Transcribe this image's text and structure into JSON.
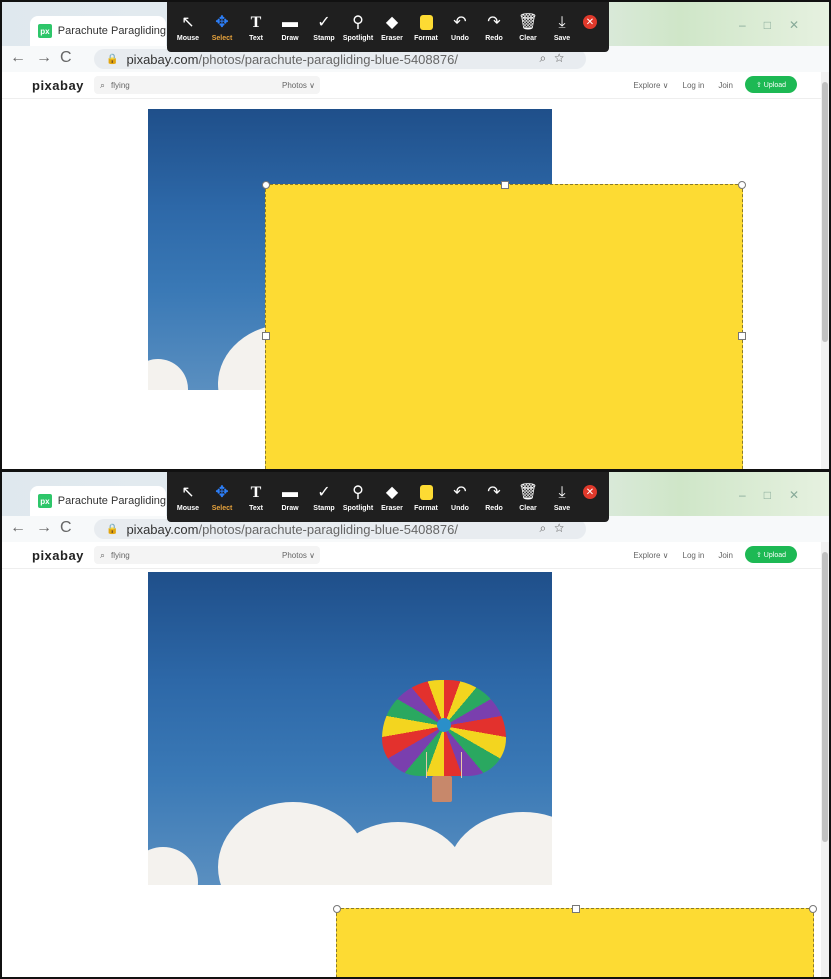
{
  "browser": {
    "tab_title": "Parachute Paragliding Blue - Free",
    "favicon_text": "px",
    "url_domain": "pixabay.com",
    "url_path": "/photos/parachute-paragliding-blue-5408876/",
    "back_icon": "arrow-left",
    "forward_icon": "arrow-right",
    "reload_icon": "reload"
  },
  "zoom_toolbar": {
    "tools": [
      {
        "label": "Mouse",
        "icon": "cursor-icon",
        "glyph": "↖"
      },
      {
        "label": "Select",
        "icon": "move-icon",
        "glyph": "✥"
      },
      {
        "label": "Text",
        "icon": "text-icon",
        "glyph": "T"
      },
      {
        "label": "Draw",
        "icon": "rectangle-icon",
        "glyph": "▬"
      },
      {
        "label": "Stamp",
        "icon": "checkmark-icon",
        "glyph": "✓"
      },
      {
        "label": "Spotlight",
        "icon": "spotlight-icon",
        "glyph": "⚲"
      },
      {
        "label": "Eraser",
        "icon": "eraser-icon",
        "glyph": "◆"
      },
      {
        "label": "Format",
        "icon": "format-icon",
        "glyph": ""
      },
      {
        "label": "Undo",
        "icon": "undo-icon",
        "glyph": "↶"
      },
      {
        "label": "Redo",
        "icon": "redo-icon",
        "glyph": "↷"
      },
      {
        "label": "Clear",
        "icon": "trash-icon",
        "glyph": "🗑"
      },
      {
        "label": "Save",
        "icon": "save-icon",
        "glyph": "⤓"
      }
    ],
    "active_tool": "Select",
    "close_glyph": "✕",
    "format_color": "#fddb33"
  },
  "site": {
    "logo": "pixabay",
    "search_value": "flying",
    "search_filter": "Photos ∨",
    "nav": [
      "Explore ∨",
      "Log in",
      "Join"
    ],
    "upload_label": "⇪ Upload",
    "accent": "#1db954"
  },
  "annotation": {
    "shape_color": "#fddb33"
  }
}
